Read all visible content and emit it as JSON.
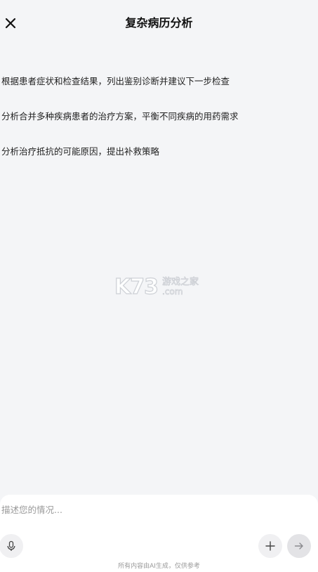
{
  "header": {
    "title": "复杂病历分析",
    "close_icon": "close-icon"
  },
  "suggestions": [
    "根据患者症状和检查结果，列出鉴别诊断并建议下一步检查",
    "分析合并多种疾病患者的治疗方案，平衡不同疾病的用药需求",
    "分析治疗抵抗的可能原因，提出补救策略"
  ],
  "watermark": {
    "logo_text": "K73",
    "cn_text": "游戏之家",
    "domain_text": ".com"
  },
  "composer": {
    "placeholder": "描述您的情况...",
    "mic_icon": "microphone-icon",
    "plus_icon": "plus-icon",
    "send_icon": "arrow-right-icon",
    "disclaimer": "所有内容由AI生成，仅供参考"
  },
  "colors": {
    "background": "#f4f5f7",
    "composer_bg": "#ffffff",
    "button_bg": "#f0f0f2",
    "muted_text": "#9a9a9a"
  }
}
